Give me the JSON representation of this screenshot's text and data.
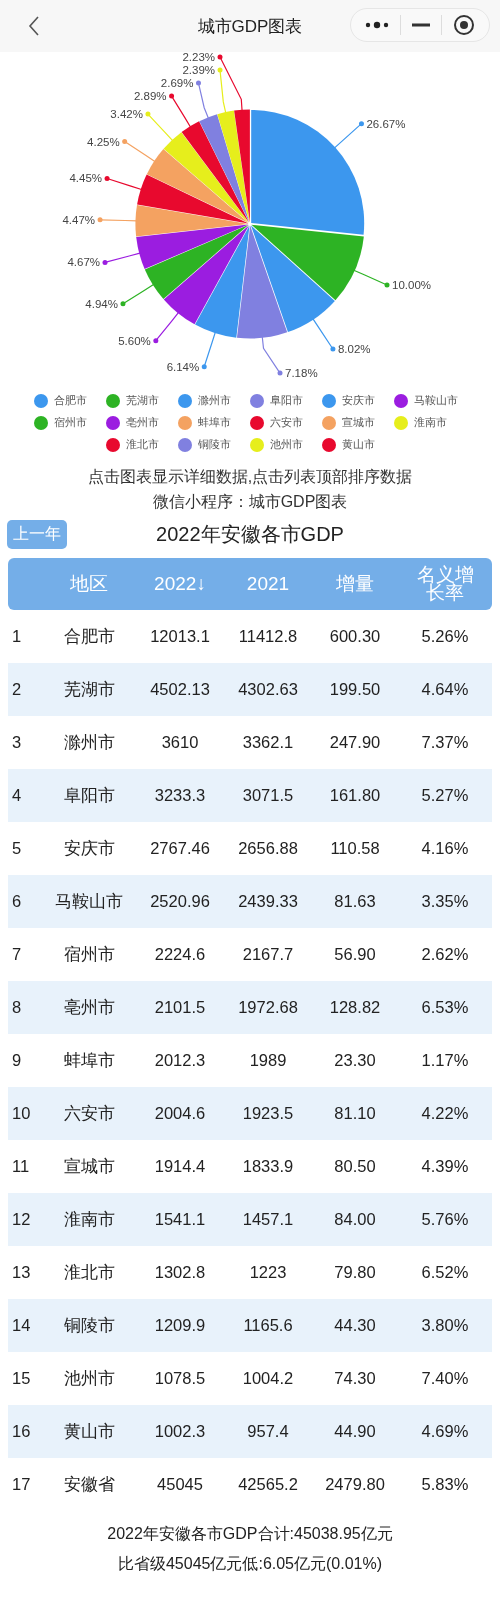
{
  "nav": {
    "title": "城市GDP图表"
  },
  "chart": {
    "chart_data": {
      "type": "pie",
      "categories": [
        "合肥市",
        "芜湖市",
        "滁州市",
        "阜阳市",
        "安庆市",
        "马鞍山市",
        "宿州市",
        "亳州市",
        "蚌埠市",
        "六安市",
        "宣城市",
        "淮南市",
        "淮北市",
        "铜陵市",
        "池州市",
        "黄山市"
      ],
      "values": [
        26.67,
        10.0,
        8.02,
        7.18,
        6.14,
        5.6,
        4.94,
        4.67,
        4.47,
        4.45,
        4.25,
        3.42,
        2.89,
        2.69,
        2.39,
        2.23
      ],
      "value_labels": [
        "26.67%",
        "10.00%",
        "8.02%",
        "7.18%",
        "6.14%",
        "5.60%",
        "4.94%",
        "4.67%",
        "4.47%",
        "4.45%",
        "4.25%",
        "3.42%",
        "2.89%",
        "2.69%",
        "2.39%",
        "2.23%"
      ]
    },
    "legend": [
      {
        "color": "#3c97ee"
      },
      {
        "color": "#2db324"
      },
      {
        "color": "#3c97ee"
      },
      {
        "color": "#8080e0"
      },
      {
        "color": "#3c97ee"
      },
      {
        "color": "#9b1de0"
      },
      {
        "color": "#2db324"
      },
      {
        "color": "#9b1de0"
      },
      {
        "color": "#f4a261"
      },
      {
        "color": "#e8092e"
      },
      {
        "color": "#f4a261"
      },
      {
        "color": "#e6ee1c"
      },
      {
        "color": "#e8092e"
      },
      {
        "color": "#8080e0"
      },
      {
        "color": "#e6ee1c"
      },
      {
        "color": "#e8092e"
      }
    ]
  },
  "hint": "点击图表显示详细数据,点击列表顶部排序数据",
  "source": "微信小程序：城市GDP图表",
  "prev_button": "上一年",
  "table_title": "2022年安徽各市GDP",
  "table": {
    "columns": [
      "",
      "地区",
      "2022↓",
      "2021",
      "增量",
      "名义增长率"
    ],
    "rows": [
      [
        "1",
        "合肥市",
        "12013.1",
        "11412.8",
        "600.30",
        "5.26%"
      ],
      [
        "2",
        "芜湖市",
        "4502.13",
        "4302.63",
        "199.50",
        "4.64%"
      ],
      [
        "3",
        "滁州市",
        "3610",
        "3362.1",
        "247.90",
        "7.37%"
      ],
      [
        "4",
        "阜阳市",
        "3233.3",
        "3071.5",
        "161.80",
        "5.27%"
      ],
      [
        "5",
        "安庆市",
        "2767.46",
        "2656.88",
        "110.58",
        "4.16%"
      ],
      [
        "6",
        "马鞍山市",
        "2520.96",
        "2439.33",
        "81.63",
        "3.35%"
      ],
      [
        "7",
        "宿州市",
        "2224.6",
        "2167.7",
        "56.90",
        "2.62%"
      ],
      [
        "8",
        "亳州市",
        "2101.5",
        "1972.68",
        "128.82",
        "6.53%"
      ],
      [
        "9",
        "蚌埠市",
        "2012.3",
        "1989",
        "23.30",
        "1.17%"
      ],
      [
        "10",
        "六安市",
        "2004.6",
        "1923.5",
        "81.10",
        "4.22%"
      ],
      [
        "11",
        "宣城市",
        "1914.4",
        "1833.9",
        "80.50",
        "4.39%"
      ],
      [
        "12",
        "淮南市",
        "1541.1",
        "1457.1",
        "84.00",
        "5.76%"
      ],
      [
        "13",
        "淮北市",
        "1302.8",
        "1223",
        "79.80",
        "6.52%"
      ],
      [
        "14",
        "铜陵市",
        "1209.9",
        "1165.6",
        "44.30",
        "3.80%"
      ],
      [
        "15",
        "池州市",
        "1078.5",
        "1004.2",
        "74.30",
        "7.40%"
      ],
      [
        "16",
        "黄山市",
        "1002.3",
        "957.4",
        "44.90",
        "4.69%"
      ],
      [
        "17",
        "安徽省",
        "45045",
        "42565.2",
        "2479.80",
        "5.83%"
      ]
    ]
  },
  "footer": [
    "2022年安徽各市GDP合计:45038.95亿元",
    "比省级45045亿元低:6.05亿元(0.01%)"
  ]
}
